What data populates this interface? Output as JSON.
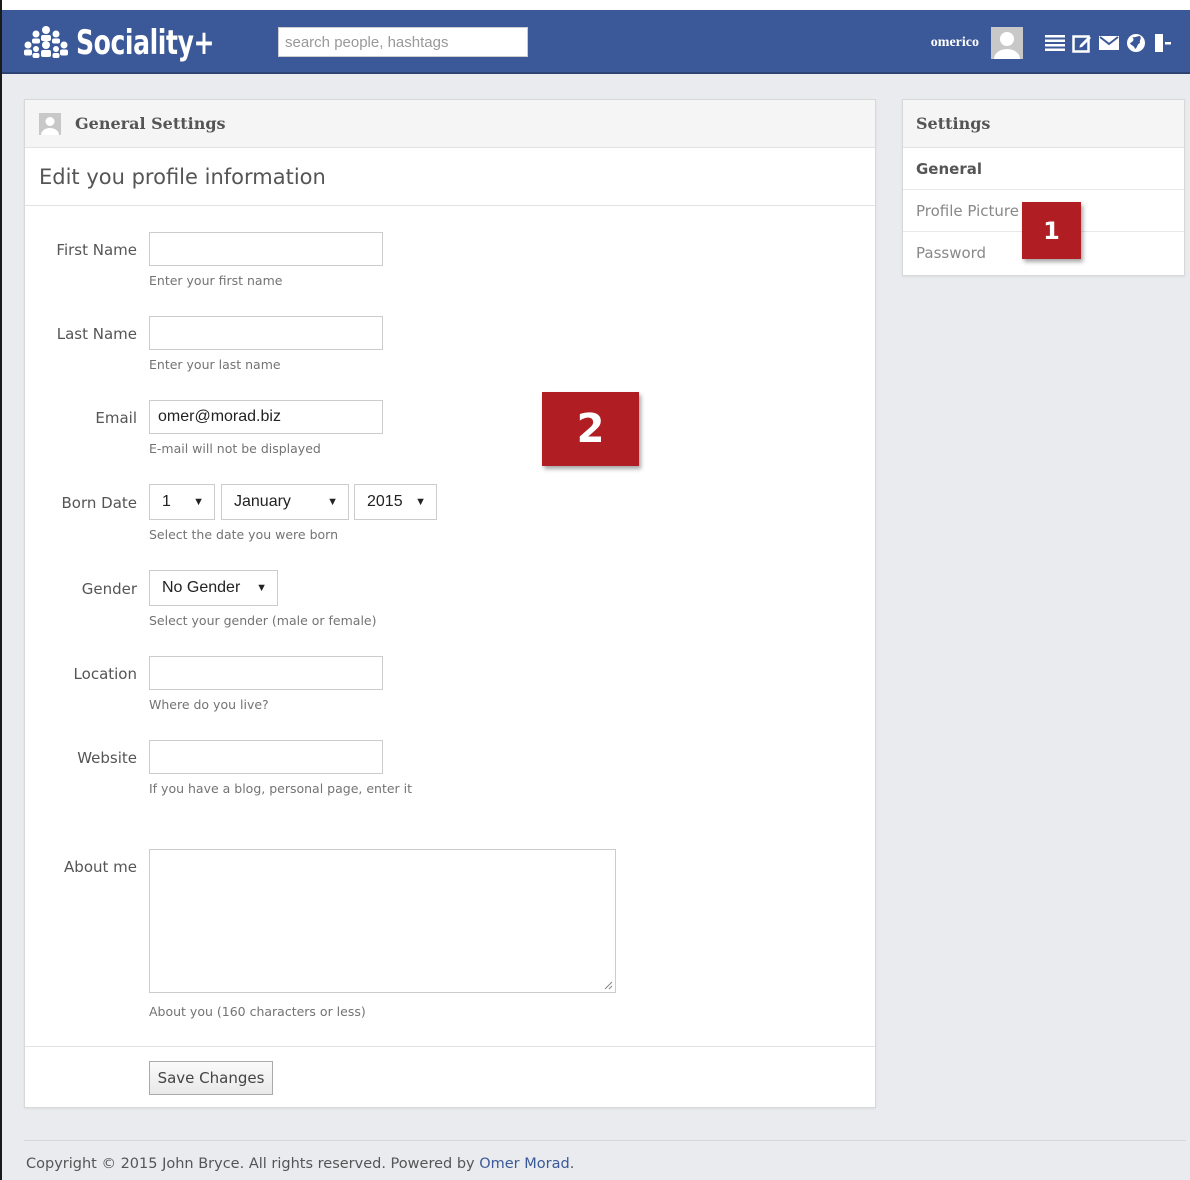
{
  "app": {
    "brand": "Sociality+",
    "accent_color": "#3b5998"
  },
  "navbar": {
    "search_placeholder": "search people, hashtags",
    "username": "omerico",
    "icons": [
      "avatar-icon",
      "feed-icon",
      "compose-icon",
      "mail-icon",
      "globe-icon",
      "logout-icon"
    ]
  },
  "main": {
    "heading": "General Settings",
    "subheading": "Edit you profile information",
    "fields": {
      "first_name": {
        "label": "First Name",
        "value": "",
        "help": "Enter your first name"
      },
      "last_name": {
        "label": "Last Name",
        "value": "",
        "help": "Enter your last name"
      },
      "email": {
        "label": "Email",
        "value": "omer@morad.biz",
        "help": "E-mail will not be displayed"
      },
      "born_date": {
        "label": "Born Date",
        "day": "1",
        "month": "January",
        "year": "2015",
        "help": "Select the date you were born"
      },
      "gender": {
        "label": "Gender",
        "value": "No Gender",
        "help": "Select your gender (male or female)"
      },
      "location": {
        "label": "Location",
        "value": "",
        "help": "Where do you live?"
      },
      "website": {
        "label": "Website",
        "value": "",
        "help": "If you have a blog, personal page, enter it"
      },
      "about": {
        "label": "About me",
        "value": "",
        "help": "About you (160 characters or less)"
      }
    },
    "save_label": "Save Changes"
  },
  "sidebar": {
    "heading": "Settings",
    "items": [
      {
        "label": "General",
        "active": true
      },
      {
        "label": "Profile Picture",
        "active": false
      },
      {
        "label": "Password",
        "active": false
      }
    ]
  },
  "badges": {
    "one": "1",
    "two": "2",
    "color": "#b01e24"
  },
  "footer": {
    "text": "Copyright © 2015 John Bryce. All rights reserved. Powered by ",
    "link": "Omer Morad",
    "end": "."
  }
}
